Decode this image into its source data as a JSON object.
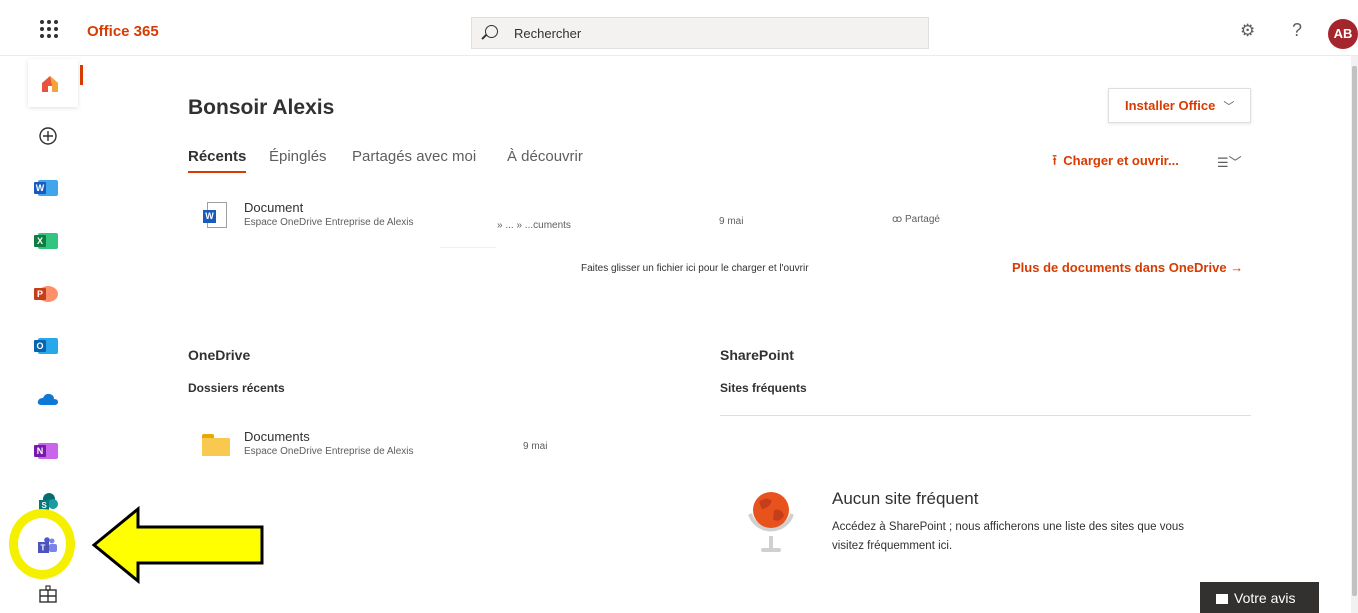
{
  "topbar": {
    "brand": "Office 365",
    "search_placeholder": "Rechercher",
    "avatar_initials": "AB"
  },
  "rail": {
    "items": [
      "home",
      "create",
      "word",
      "excel",
      "powerpoint",
      "outlook",
      "onedrive",
      "onenote",
      "sharepoint",
      "teams",
      "all-apps"
    ]
  },
  "main": {
    "greeting": "Bonsoir Alexis",
    "install_label": "Installer Office",
    "tabs": [
      {
        "label": "Récents",
        "active": true
      },
      {
        "label": "Épinglés",
        "active": false
      },
      {
        "label": "Partagés avec moi",
        "active": false
      },
      {
        "label": "À découvrir",
        "active": false
      }
    ],
    "upload_label": "Charger et ouvrir...",
    "recent_doc": {
      "name": "Document",
      "location": "Espace OneDrive Entreprise de Alexis",
      "path": "» ... » ...cuments",
      "date": "9 mai",
      "shared": "Partagé"
    },
    "drop_hint": "Faites glisser un fichier ici pour le charger et l'ouvrir",
    "more_docs": "Plus de documents dans OneDrive"
  },
  "onedrive": {
    "title": "OneDrive",
    "subtitle": "Dossiers récents",
    "folder": {
      "name": "Documents",
      "location": "Espace OneDrive Entreprise de Alexis",
      "date": "9 mai"
    }
  },
  "sharepoint": {
    "title": "SharePoint",
    "subtitle": "Sites fréquents",
    "empty_title": "Aucun site fréquent",
    "empty_text": "Accédez à SharePoint ; nous afficherons une liste des sites que vous visitez fréquemment ici."
  },
  "feedback_label": "Votre avis",
  "colors": {
    "accent": "#d83b01",
    "annotation": "#f4f000"
  }
}
